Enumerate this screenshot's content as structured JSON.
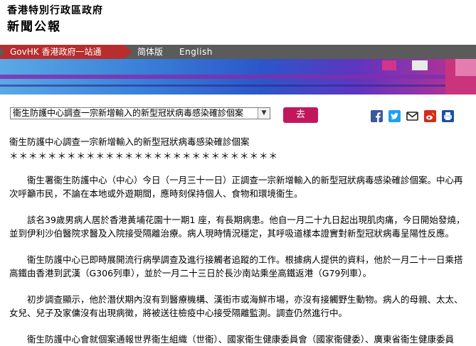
{
  "header": {
    "gov_name": "香港特別行政區政府",
    "section_title": "新聞公報"
  },
  "nav": {
    "govhk": "GovHK 香港政府一站通",
    "simplified": "简体版",
    "english": "English"
  },
  "colors": {
    "nav_red": "#b72e2e",
    "nav_gray": "#5b5b5b",
    "button": "#c2185b"
  },
  "toolbar": {
    "select_value": "衞生防護中心調查一宗新增輸入的新型冠狀病毒感染確診個案",
    "go_label": "去",
    "share_icons": [
      "facebook-icon",
      "twitter-icon",
      "email-icon",
      "weibo-icon",
      "print-icon"
    ]
  },
  "article": {
    "title": "衞生防護中心調查一宗新增輸入的新型冠狀病毒感染確診個案",
    "stars": "＊＊＊＊＊＊＊＊＊＊＊＊＊＊＊＊＊＊＊＊＊＊＊＊＊＊＊＊",
    "paragraphs": [
      "衞生署衞生防護中心（中心）今日（一月三十一日）正調查一宗新增輸入的新型冠狀病毒感染確診個案。中心再次呼籲市民，不論在本地或外遊期間，應時刻保持個人、食物和環境衞生。",
      "該名39歲男病人居於香港黃埔花園十一期1 座，有長期病患。他自一月二十九日起出現肌肉痛，今日開始發燒，並到伊利沙伯醫院求醫及入院接受隔離治療。病人現時情況穩定，其呼吸道樣本證實對新型冠狀病毒呈陽性反應。",
      "衞生防護中心已即時展開流行病學調查及進行接觸者追蹤的工作。根據病人提供的資料，他於一月二十一日乘搭高鐵由香港到武漢（G306列車），並於一月二十三日於長沙南站乘坐高鐵返港（G79列車）。",
      "初步調查顯示，他於潛伏期內沒有到醫療機構、漢街市或海鮮市場，亦沒有接觸野生動物。病人的母親、太太、女兒、兒子及家傭沒有出現病徵，將被送往檢疫中心接受隔離監測。調查仍然進行中。",
      "衞生防護中心會就個案通報世界衞生組織（世衞）、國家衞生健康委員會（國家衞健委）、廣東省衞生健康委員"
    ]
  }
}
